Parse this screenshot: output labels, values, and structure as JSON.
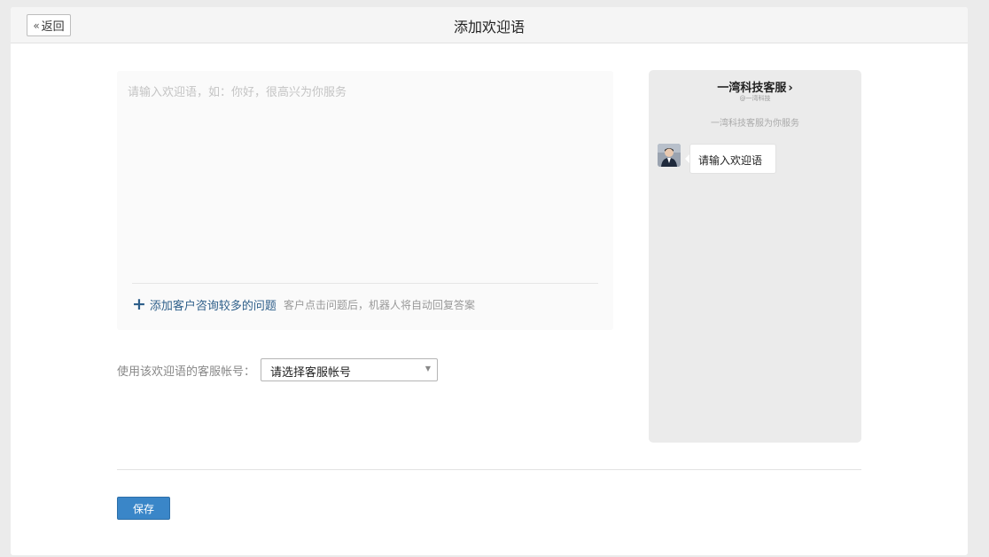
{
  "header": {
    "back_label": "返回",
    "title": "添加欢迎语"
  },
  "editor": {
    "placeholder": "请输入欢迎语，如：你好，很高兴为你服务",
    "value": "",
    "add_question_label": "添加客户咨询较多的问题",
    "add_question_hint": "客户点击问题后，机器人将自动回复答案"
  },
  "account": {
    "label": "使用该欢迎语的客服帐号：",
    "selected": "请选择客服帐号"
  },
  "preview": {
    "name": "一湾科技客服",
    "subtitle": "@一湾科技",
    "note": "一湾科技客服为你服务",
    "bubble_text": "请输入欢迎语"
  },
  "footer": {
    "save_label": "保存"
  },
  "colors": {
    "primary": "#3a86c8",
    "link": "#2e5f8a",
    "preview_bg": "#ebebeb"
  },
  "icons": {
    "back": "double-chevron-left-icon",
    "add": "plus-icon",
    "dropdown": "caret-down-icon",
    "name_suffix": "chevron-right-icon",
    "avatar": "avatar-image"
  }
}
